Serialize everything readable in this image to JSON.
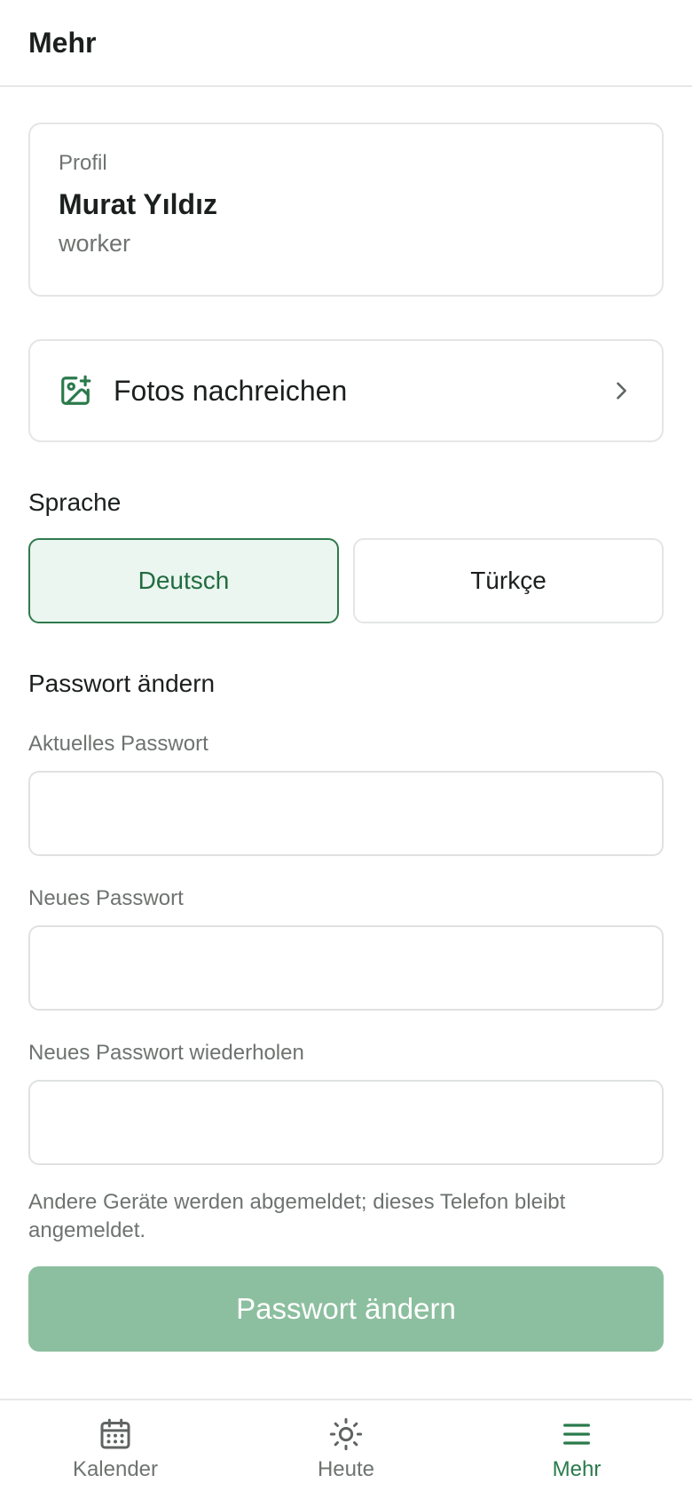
{
  "header": {
    "title": "Mehr"
  },
  "profile": {
    "label": "Profil",
    "name": "Murat Yıldız",
    "role": "worker"
  },
  "photos": {
    "label": "Fotos nachreichen",
    "icon": "image-plus-icon"
  },
  "language": {
    "title": "Sprache",
    "options": [
      {
        "label": "Deutsch",
        "selected": true
      },
      {
        "label": "Türkçe",
        "selected": false
      }
    ]
  },
  "password": {
    "title": "Passwort ändern",
    "current_label": "Aktuelles Passwort",
    "current_value": "",
    "new_label": "Neues Passwort",
    "new_value": "",
    "repeat_label": "Neues Passwort wiederholen",
    "repeat_value": "",
    "hint": "Andere Geräte werden abgemeldet; dieses Telefon bleibt angemeldet.",
    "submit_label": "Passwort ändern"
  },
  "nav": {
    "items": [
      {
        "label": "Kalender",
        "icon": "calendar-icon",
        "active": false
      },
      {
        "label": "Heute",
        "icon": "sun-icon",
        "active": false
      },
      {
        "label": "Mehr",
        "icon": "menu-icon",
        "active": true
      }
    ]
  },
  "colors": {
    "accent": "#2a7a4b",
    "accent_light": "#eaf6ef",
    "button_disabled": "#8cbf9f",
    "muted_text": "#6e7370"
  }
}
